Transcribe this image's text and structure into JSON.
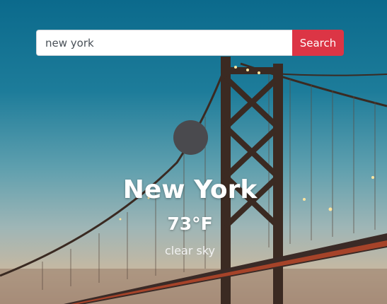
{
  "search": {
    "value": "new york",
    "button_label": "Search"
  },
  "weather": {
    "icon": "weather-icon",
    "city": "New York",
    "temperature": "73°F",
    "description": "clear sky"
  },
  "colors": {
    "search_button": "#dc3545",
    "icon_placeholder": "#4a4a4e"
  }
}
